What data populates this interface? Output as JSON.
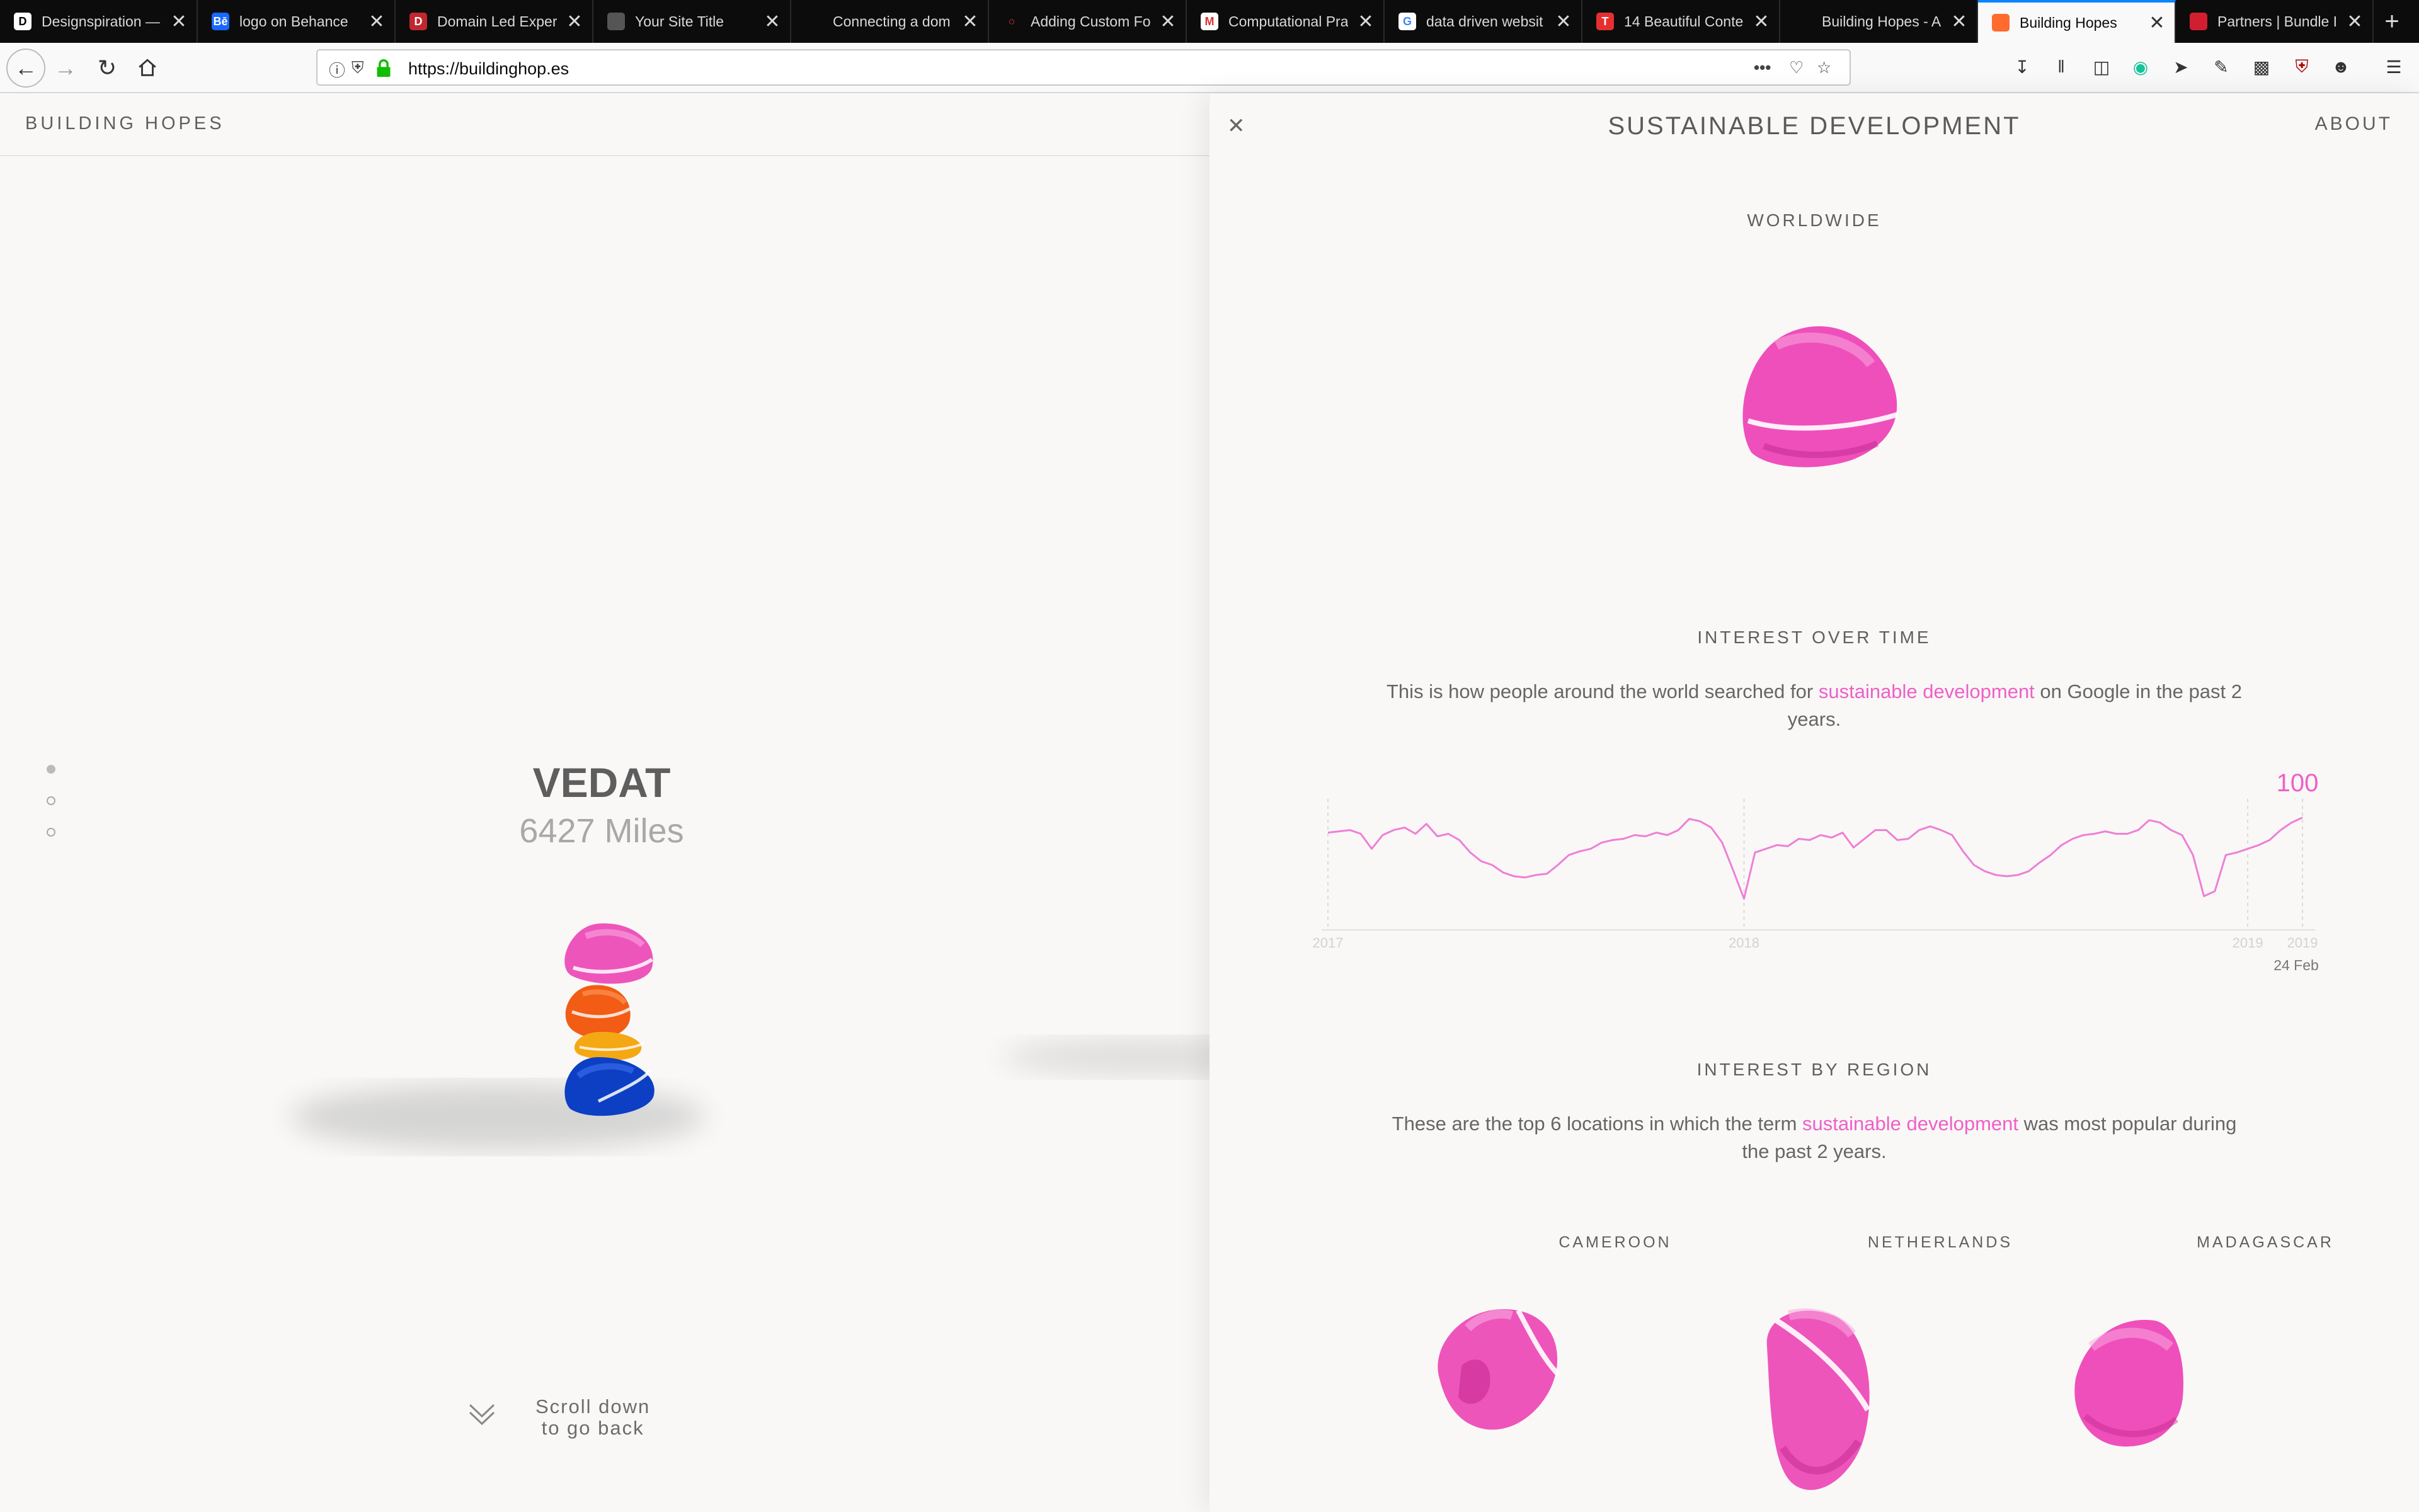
{
  "browser": {
    "tabs": [
      {
        "title": "Designspiration —",
        "fav": "D",
        "color": "#ffffff",
        "fg": "#000"
      },
      {
        "title": "logo on Behance",
        "fav": "Bē",
        "color": "#1769ff",
        "fg": "#fff"
      },
      {
        "title": "Domain Led Exper",
        "fav": "D",
        "color": "#c0282e",
        "fg": "#fff"
      },
      {
        "title": "Your Site Title",
        "fav": "",
        "color": "#555555",
        "fg": "#fff"
      },
      {
        "title": "Connecting a dom",
        "fav": "",
        "color": "#0c0c0d",
        "fg": "#fff"
      },
      {
        "title": "Adding Custom Fo",
        "fav": "○",
        "color": "#0c0c0d",
        "fg": "#e33"
      },
      {
        "title": "Computational Pra",
        "fav": "M",
        "color": "#ffffff",
        "fg": "#d33"
      },
      {
        "title": "data driven websit",
        "fav": "G",
        "color": "#ffffff",
        "fg": "#4285f4"
      },
      {
        "title": "14 Beautiful Conte",
        "fav": "T",
        "color": "#e5302f",
        "fg": "#fff"
      },
      {
        "title": "Building Hopes - A",
        "fav": "",
        "color": "#0c0c0d",
        "fg": "#fff"
      },
      {
        "title": "Building Hopes",
        "fav": "",
        "color": "#ff6a2e",
        "fg": "#fff",
        "active": true
      },
      {
        "title": "Partners | Bundle I",
        "fav": "",
        "color": "#d11f2f",
        "fg": "#fff"
      }
    ],
    "url": "https://buildinghop.es"
  },
  "site": {
    "title": "BUILDING HOPES",
    "about": "ABOUT"
  },
  "person": {
    "name": "VEDAT",
    "miles": "6427 Miles"
  },
  "scroll_hint": {
    "line1": "Scroll down",
    "line2": "to go back"
  },
  "panel": {
    "topic": "SUSTAINABLE DEVELOPMENT",
    "worldwide_heading": "WORLDWIDE",
    "interest_time_heading": "INTEREST OVER TIME",
    "interest_time_pre": "This is how people around the world searched for ",
    "interest_time_term": "sustainable development",
    "interest_time_post": " on Google in the past 2 years.",
    "interest_region_heading": "INTEREST BY REGION",
    "interest_region_pre": "These are the top 6 locations in which the term ",
    "interest_region_term": "sustainable development",
    "interest_region_post": " was most popular during the past 2 years.",
    "regions": [
      "CAMEROON",
      "NETHERLANDS",
      "MADAGASCAR"
    ]
  },
  "chart_data": {
    "type": "line",
    "title": "",
    "xlabel": "",
    "ylabel": "",
    "x_ticks": [
      "2017",
      "2018",
      "2019",
      "2019"
    ],
    "peak_label": "100",
    "last_date_label": "24 Feb",
    "ylim": [
      0,
      100
    ],
    "series": [
      {
        "color": "#ef7fd6",
        "values": [
          78,
          79,
          80,
          77,
          65,
          76,
          80,
          82,
          77,
          85,
          75,
          77,
          72,
          62,
          55,
          52,
          46,
          43,
          42,
          44,
          45,
          52,
          60,
          63,
          65,
          70,
          72,
          73,
          76,
          75,
          78,
          76,
          80,
          89,
          87,
          82,
          70,
          48,
          25,
          62,
          65,
          68,
          67,
          73,
          72,
          76,
          74,
          78,
          66,
          73,
          80,
          80,
          72,
          73,
          80,
          83,
          80,
          76,
          63,
          52,
          47,
          44,
          43,
          44,
          47,
          54,
          60,
          68,
          73,
          76,
          77,
          79,
          77,
          77,
          80,
          88,
          86,
          80,
          76,
          60,
          27,
          31,
          60,
          62,
          65,
          68,
          72,
          80,
          86,
          90
        ]
      }
    ]
  },
  "colors": {
    "accent_pink": "#ef5fc8",
    "line_pink": "#ef7fd6"
  }
}
